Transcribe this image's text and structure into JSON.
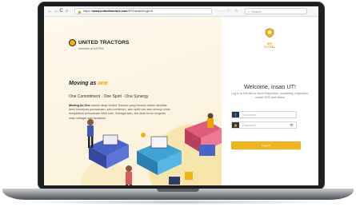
{
  "browser": {
    "nav_back": "←",
    "nav_forward": "→",
    "nav_reload": "C",
    "nav_home": "⌂",
    "url_prefix": "https://",
    "url_domain": "www.unitedtractors.com",
    "url_path": "/EPinstall/#/login/8",
    "icons": "··· ♡ ☆",
    "search_placeholder": "Search"
  },
  "brand": {
    "name": "UNITED TRACTORS",
    "sub": "member of ASTRA"
  },
  "hero": {
    "moving_prefix": "Moving as ",
    "moving_one": "one",
    "values": "One Commitment · One Spirit · One Synergy",
    "desc_bold": "Moving As One",
    "desc_rest": " adalah sikap United Tractors yang bersatu dalam identitas demi kemajuan perusahaan, satu komitmen, satu spirit dan satu sinergi untuk menjadikan perusahaan lebih baik. Sebagai satu, kita akan terus bergerak maju sebagai satu kesatuan."
  },
  "app": {
    "logo_label": "EPI POTTAL"
  },
  "login": {
    "welcome": "Welcome, Insan UT!",
    "subtitle": "Log in to this site to report inspection, monitoring, inspection, create SOS and others",
    "username_placeholder": "Username",
    "password_placeholder": "Password",
    "button_label": "Log In"
  },
  "colors": {
    "accent": "#f2b319",
    "dark": "#1d1f21"
  }
}
